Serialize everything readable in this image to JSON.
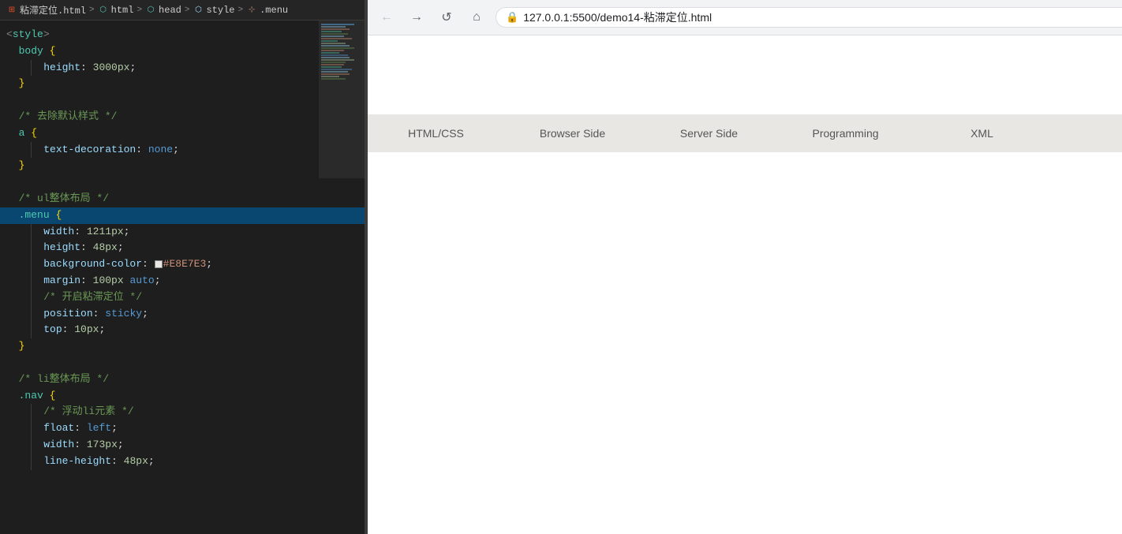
{
  "breadcrumb": {
    "items": [
      {
        "label": "粘滞定位.html",
        "icon": "file-icon"
      },
      {
        "sep": ">"
      },
      {
        "label": "html",
        "icon": "html-icon"
      },
      {
        "sep": ">"
      },
      {
        "label": "head",
        "icon": "head-icon"
      },
      {
        "sep": ">"
      },
      {
        "label": "style",
        "icon": "style-icon"
      },
      {
        "sep": ">"
      },
      {
        "label": ".menu",
        "icon": "menu-icon"
      }
    ]
  },
  "code": {
    "lines": [
      {
        "indent": 0,
        "content": "<style>"
      },
      {
        "indent": 2,
        "content": "body {"
      },
      {
        "indent": 4,
        "content": "height: 3000px;"
      },
      {
        "indent": 2,
        "content": "}"
      },
      {
        "indent": 0,
        "content": ""
      },
      {
        "indent": 2,
        "content": "/* 去除默认样式 */"
      },
      {
        "indent": 2,
        "content": "a {"
      },
      {
        "indent": 4,
        "content": "text-decoration: none;"
      },
      {
        "indent": 2,
        "content": "}"
      },
      {
        "indent": 0,
        "content": ""
      },
      {
        "indent": 2,
        "content": "/* ul整体布局 */"
      },
      {
        "indent": 2,
        "content": ".menu {"
      },
      {
        "indent": 4,
        "content": "width: 1211px;"
      },
      {
        "indent": 4,
        "content": "height: 48px;"
      },
      {
        "indent": 4,
        "content": "background-color: #E8E7E3;"
      },
      {
        "indent": 4,
        "content": "margin: 100px auto;"
      },
      {
        "indent": 4,
        "content": "/* 开启粘滞定位 */"
      },
      {
        "indent": 4,
        "content": "position: sticky;"
      },
      {
        "indent": 4,
        "content": "top: 10px;"
      },
      {
        "indent": 2,
        "content": "}"
      },
      {
        "indent": 0,
        "content": ""
      },
      {
        "indent": 2,
        "content": "/* li整体布局 */"
      },
      {
        "indent": 2,
        "content": ".nav {"
      },
      {
        "indent": 4,
        "content": "/* 浮动li元素 */"
      },
      {
        "indent": 4,
        "content": "float: left;"
      },
      {
        "indent": 4,
        "content": "width: 173px;"
      },
      {
        "indent": 4,
        "content": "line-height: 48px;"
      }
    ]
  },
  "browser": {
    "back_label": "←",
    "forward_label": "→",
    "reload_label": "↺",
    "home_label": "⌂",
    "url": "127.0.0.1:5500/demo14-粘滞定位.html",
    "zoom_label": "🔍",
    "star_label": "☆",
    "ext_label": "🧩",
    "more_label": "⋮",
    "nav_items": [
      {
        "label": "HTML/CSS"
      },
      {
        "label": "Browser Side"
      },
      {
        "label": "Server Side"
      },
      {
        "label": "Programming"
      },
      {
        "label": "XML"
      }
    ]
  }
}
